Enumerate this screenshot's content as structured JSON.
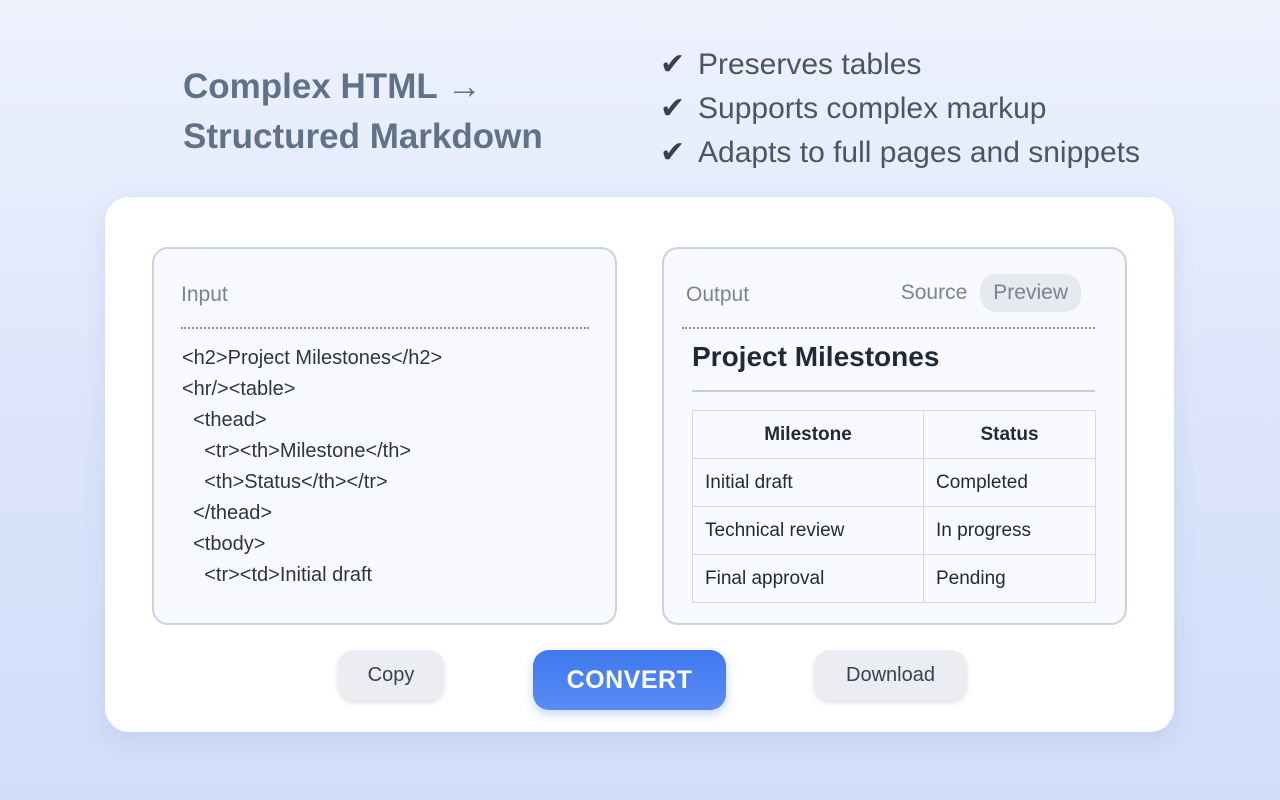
{
  "hero": {
    "line1": "Complex HTML →",
    "line2": "Structured Markdown",
    "check_glyph": "✔",
    "features": [
      "Preserves tables",
      "Supports complex markup",
      "Adapts to full pages and snippets"
    ]
  },
  "input_panel": {
    "label": "Input",
    "code_lines": [
      "<h2>Project Milestones</h2>",
      "<hr/><table>",
      "  <thead>",
      "    <tr><th>Milestone</th>",
      "    <th>Status</th></tr>",
      "  </thead>",
      "  <tbody>",
      "    <tr><td>Initial draft"
    ]
  },
  "output_panel": {
    "label": "Output",
    "tabs": {
      "source": "Source",
      "preview": "Preview",
      "active": "preview"
    },
    "preview": {
      "title": "Project Milestones",
      "headers": [
        "Milestone",
        "Status"
      ],
      "rows": [
        [
          "Initial draft",
          "Completed"
        ],
        [
          "Technical review",
          "In progress"
        ],
        [
          "Final approval",
          "Pending"
        ]
      ]
    }
  },
  "actions": {
    "copy": "Copy",
    "convert": "CONVERT",
    "download": "Download"
  },
  "colors": {
    "accent": "#4a80f2",
    "headline": "#5f7288"
  }
}
